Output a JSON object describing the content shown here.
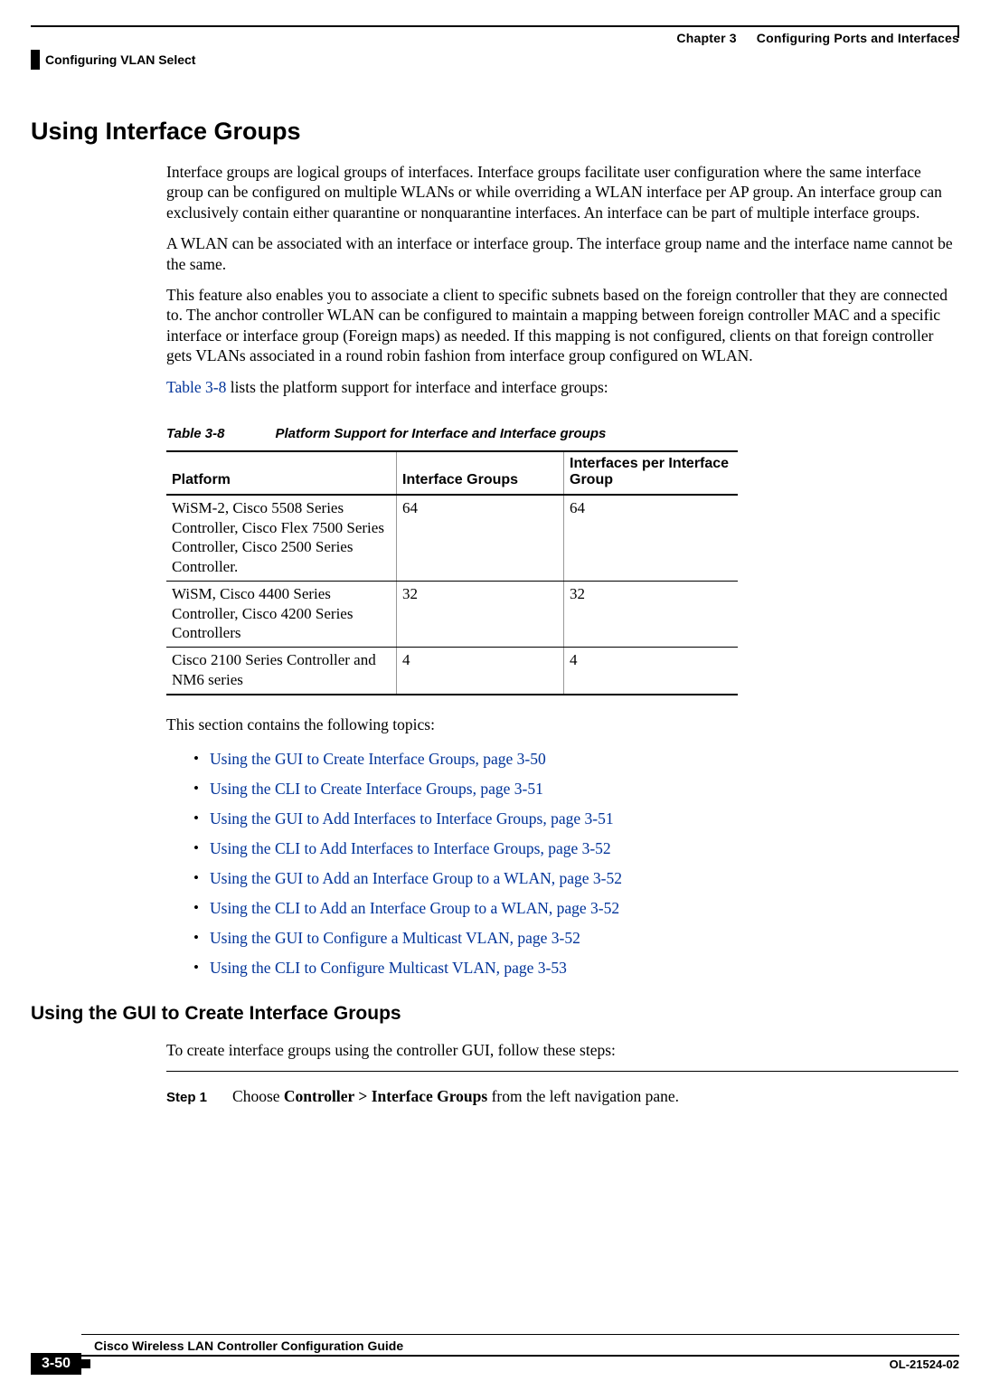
{
  "header": {
    "chapter_label": "Chapter 3",
    "chapter_title": "Configuring Ports and Interfaces",
    "section_left": "Configuring VLAN Select"
  },
  "section": {
    "title": "Using Interface Groups",
    "paragraphs": {
      "p1": "Interface groups are logical groups of interfaces. Interface groups facilitate user configuration where the same interface group can be configured on multiple WLANs or while overriding a WLAN interface per AP group. An interface group can exclusively contain either quarantine or nonquarantine interfaces. An interface can be part of multiple interface groups.",
      "p2": "A WLAN can be associated with an interface or interface group. The interface group name and the interface name cannot be the same.",
      "p3": "This feature also enables you to associate a client to specific subnets based on the foreign controller that they are connected to. The anchor controller WLAN can be configured to maintain a mapping between foreign controller MAC and a specific interface or interface group (Foreign maps) as needed. If this mapping is not configured, clients on that foreign controller gets VLANs associated in a round robin fashion from interface group configured on WLAN.",
      "p4_xref": "Table 3-8",
      "p4_rest": " lists the platform support for interface and interface groups:"
    }
  },
  "table": {
    "number": "Table 3-8",
    "caption": "Platform Support for Interface and Interface groups",
    "headers": {
      "h1": "Platform",
      "h2": "Interface Groups",
      "h3": "Interfaces per Interface Group"
    },
    "rows": {
      "r0": {
        "c0": "WiSM-2, Cisco 5508 Series Controller, Cisco Flex 7500 Series Controller, Cisco 2500 Series Controller.",
        "c1": "64",
        "c2": "64"
      },
      "r1": {
        "c0": "WiSM, Cisco 4400 Series Controller, Cisco 4200 Series Controllers",
        "c1": "32",
        "c2": "32"
      },
      "r2": {
        "c0": "Cisco 2100 Series Controller and NM6 series",
        "c1": "4",
        "c2": "4"
      }
    }
  },
  "topics": {
    "intro": "This section contains the following topics:",
    "items": {
      "t0": "Using the GUI to Create Interface Groups, page 3-50",
      "t1": "Using the CLI to Create Interface Groups, page 3-51",
      "t2": "Using the GUI to Add Interfaces to Interface Groups, page 3-51",
      "t3": "Using the CLI to Add Interfaces to Interface Groups, page 3-52",
      "t4": "Using the GUI to Add an Interface Group to a WLAN, page 3-52",
      "t5": "Using the CLI to Add an Interface Group to a WLAN, page 3-52",
      "t6": "Using the GUI to Configure a Multicast VLAN, page 3-52",
      "t7": "Using the CLI to Configure Multicast VLAN, page 3-53"
    }
  },
  "subsection": {
    "title": "Using the GUI to Create Interface Groups",
    "intro": "To create interface groups using the controller GUI, follow these steps:",
    "step1": {
      "label": "Step 1",
      "before": "Choose ",
      "bold": "Controller > Interface Groups",
      "after": " from the left navigation pane."
    }
  },
  "footer": {
    "book_title": "Cisco Wireless LAN Controller Configuration Guide",
    "page_number": "3-50",
    "doc_number": "OL-21524-02"
  }
}
